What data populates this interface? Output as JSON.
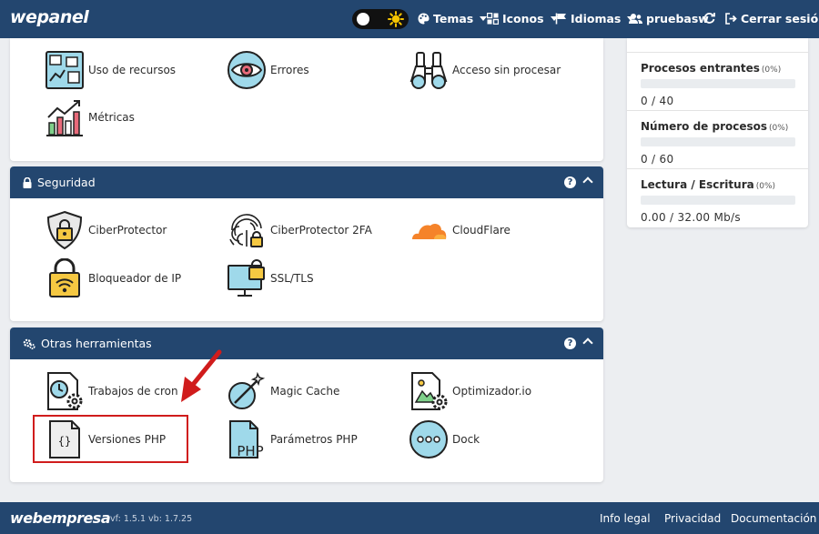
{
  "header": {
    "logo": "wepanel",
    "nav": {
      "temas": "Temas",
      "iconos": "Iconos",
      "idiomas": "Idiomas",
      "user": "pruebasw",
      "logout": "Cerrar sesión"
    }
  },
  "stats": {
    "procesos_entrantes": {
      "label": "Procesos entrantes",
      "pct": "(0%)",
      "value": "0 / 40",
      "fill": 0
    },
    "numero_procesos": {
      "label": "Número de procesos",
      "pct": "(0%)",
      "value": "0 / 60",
      "fill": 0
    },
    "lectura_escritura": {
      "label": "Lectura / Escritura",
      "pct": "(0%)",
      "value": "0.00 / 32.00 Mb/s",
      "fill": 0
    }
  },
  "panels": {
    "metrics_tools": [
      "Uso de recursos",
      "Errores",
      "Acceso sin procesar",
      "Métricas"
    ],
    "security": {
      "title": "Seguridad",
      "tools": [
        "CiberProtector",
        "CiberProtector 2FA",
        "CloudFlare",
        "Bloqueador de IP",
        "SSL/TLS"
      ]
    },
    "other": {
      "title": "Otras herramientas",
      "tools": [
        "Trabajos de cron",
        "Magic Cache",
        "Optimizador.io",
        "Versiones PHP",
        "Parámetros PHP",
        "Dock"
      ]
    }
  },
  "help_glyph": "?",
  "footer": {
    "logo": "webempresa",
    "version": "vf: 1.5.1 vb: 1.7.25",
    "links": [
      "Info legal",
      "Privacidad",
      "Documentación"
    ]
  },
  "colors": {
    "brand": "#23466f",
    "highlight": "#d01c1c",
    "background": "#eceef1"
  }
}
